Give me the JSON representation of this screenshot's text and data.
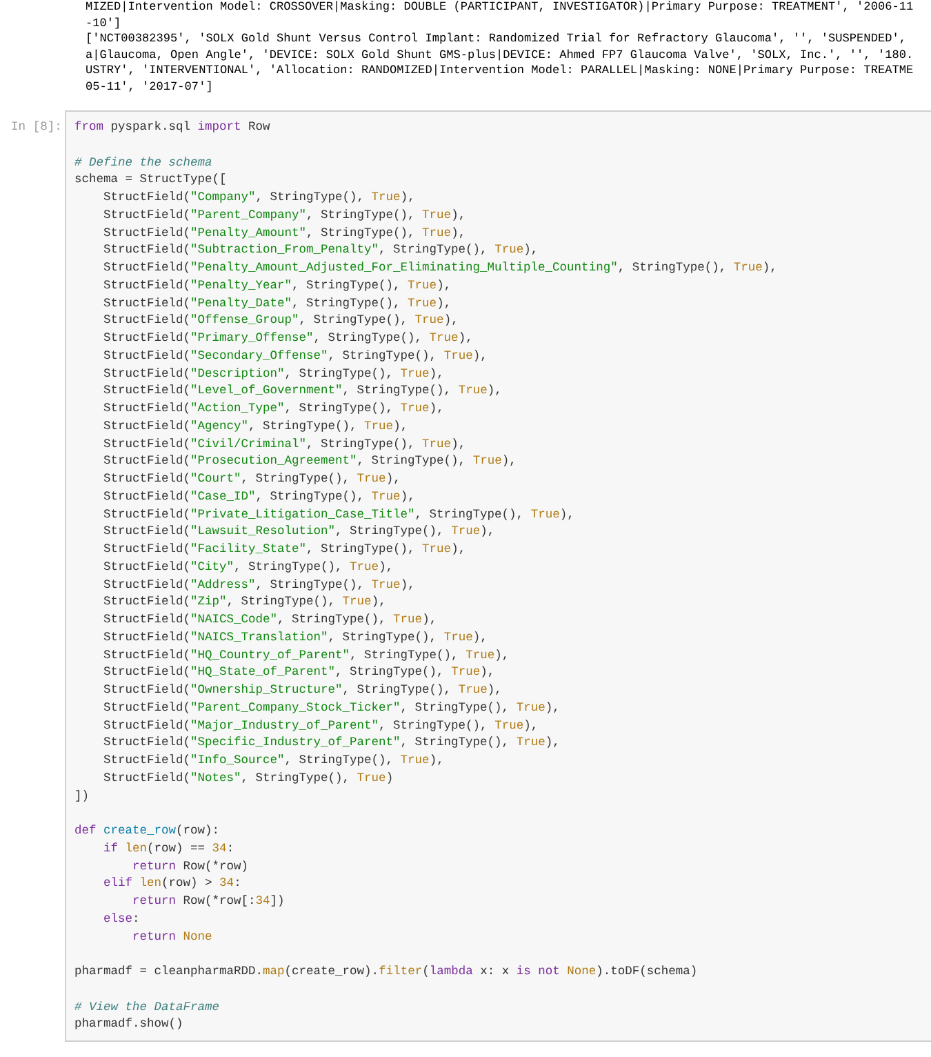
{
  "output": {
    "lines": [
      "MIZED|Intervention Model: CROSSOVER|Masking: DOUBLE (PARTICIPANT, INVESTIGATOR)|Primary Purpose: TREATMENT', '2006-11",
      "-10']",
      "['NCT00382395', 'SOLX Gold Shunt Versus Control Implant: Randomized Trial for Refractory Glaucoma', '', 'SUSPENDED',",
      "a|Glaucoma, Open Angle', 'DEVICE: SOLX Gold Shunt GMS-plus|DEVICE: Ahmed FP7 Glaucoma Valve', 'SOLX, Inc.', '', '180.",
      "USTRY', 'INTERVENTIONAL', 'Allocation: RANDOMIZED|Intervention Model: PARALLEL|Masking: NONE|Primary Purpose: TREATME",
      "05-11', '2017-07']"
    ]
  },
  "cell": {
    "prompt": "In [8]:",
    "lines": [
      {
        "tokens": [
          {
            "kind": "keyword",
            "text": "from"
          },
          {
            "kind": "plain",
            "text": " pyspark.sql "
          },
          {
            "kind": "keyword",
            "text": "import"
          },
          {
            "kind": "plain",
            "text": " Row"
          }
        ]
      },
      {
        "kind": "blank"
      },
      {
        "tokens": [
          {
            "kind": "comment",
            "text": "# Define the schema"
          }
        ]
      },
      {
        "tokens": [
          {
            "kind": "plain",
            "text": "schema = StructType(["
          }
        ]
      },
      {
        "tokens": [
          {
            "kind": "plain",
            "text": "    StructField("
          },
          {
            "kind": "string",
            "text": "\"Company\""
          },
          {
            "kind": "plain",
            "text": ", StringType(), "
          },
          {
            "kind": "constant",
            "text": "True"
          },
          {
            "kind": "plain",
            "text": "),"
          }
        ]
      },
      {
        "tokens": [
          {
            "kind": "plain",
            "text": "    StructField("
          },
          {
            "kind": "string",
            "text": "\"Parent_Company\""
          },
          {
            "kind": "plain",
            "text": ", StringType(), "
          },
          {
            "kind": "constant",
            "text": "True"
          },
          {
            "kind": "plain",
            "text": "),"
          }
        ]
      },
      {
        "tokens": [
          {
            "kind": "plain",
            "text": "    StructField("
          },
          {
            "kind": "string",
            "text": "\"Penalty_Amount\""
          },
          {
            "kind": "plain",
            "text": ", StringType(), "
          },
          {
            "kind": "constant",
            "text": "True"
          },
          {
            "kind": "plain",
            "text": "),"
          }
        ]
      },
      {
        "tokens": [
          {
            "kind": "plain",
            "text": "    StructField("
          },
          {
            "kind": "string",
            "text": "\"Subtraction_From_Penalty\""
          },
          {
            "kind": "plain",
            "text": ", StringType(), "
          },
          {
            "kind": "constant",
            "text": "True"
          },
          {
            "kind": "plain",
            "text": "),"
          }
        ]
      },
      {
        "tokens": [
          {
            "kind": "plain",
            "text": "    StructField("
          },
          {
            "kind": "string",
            "text": "\"Penalty_Amount_Adjusted_For_Eliminating_Multiple_Counting\""
          },
          {
            "kind": "plain",
            "text": ", StringType(), "
          },
          {
            "kind": "constant",
            "text": "True"
          },
          {
            "kind": "plain",
            "text": "),"
          }
        ]
      },
      {
        "tokens": [
          {
            "kind": "plain",
            "text": "    StructField("
          },
          {
            "kind": "string",
            "text": "\"Penalty_Year\""
          },
          {
            "kind": "plain",
            "text": ", StringType(), "
          },
          {
            "kind": "constant",
            "text": "True"
          },
          {
            "kind": "plain",
            "text": "),"
          }
        ]
      },
      {
        "tokens": [
          {
            "kind": "plain",
            "text": "    StructField("
          },
          {
            "kind": "string",
            "text": "\"Penalty_Date\""
          },
          {
            "kind": "plain",
            "text": ", StringType(), "
          },
          {
            "kind": "constant",
            "text": "True"
          },
          {
            "kind": "plain",
            "text": "),"
          }
        ]
      },
      {
        "tokens": [
          {
            "kind": "plain",
            "text": "    StructField("
          },
          {
            "kind": "string",
            "text": "\"Offense_Group\""
          },
          {
            "kind": "plain",
            "text": ", StringType(), "
          },
          {
            "kind": "constant",
            "text": "True"
          },
          {
            "kind": "plain",
            "text": "),"
          }
        ]
      },
      {
        "tokens": [
          {
            "kind": "plain",
            "text": "    StructField("
          },
          {
            "kind": "string",
            "text": "\"Primary_Offense\""
          },
          {
            "kind": "plain",
            "text": ", StringType(), "
          },
          {
            "kind": "constant",
            "text": "True"
          },
          {
            "kind": "plain",
            "text": "),"
          }
        ]
      },
      {
        "tokens": [
          {
            "kind": "plain",
            "text": "    StructField("
          },
          {
            "kind": "string",
            "text": "\"Secondary_Offense\""
          },
          {
            "kind": "plain",
            "text": ", StringType(), "
          },
          {
            "kind": "constant",
            "text": "True"
          },
          {
            "kind": "plain",
            "text": "),"
          }
        ]
      },
      {
        "tokens": [
          {
            "kind": "plain",
            "text": "    StructField("
          },
          {
            "kind": "string",
            "text": "\"Description\""
          },
          {
            "kind": "plain",
            "text": ", StringType(), "
          },
          {
            "kind": "constant",
            "text": "True"
          },
          {
            "kind": "plain",
            "text": "),"
          }
        ]
      },
      {
        "tokens": [
          {
            "kind": "plain",
            "text": "    StructField("
          },
          {
            "kind": "string",
            "text": "\"Level_of_Government\""
          },
          {
            "kind": "plain",
            "text": ", StringType(), "
          },
          {
            "kind": "constant",
            "text": "True"
          },
          {
            "kind": "plain",
            "text": "),"
          }
        ]
      },
      {
        "tokens": [
          {
            "kind": "plain",
            "text": "    StructField("
          },
          {
            "kind": "string",
            "text": "\"Action_Type\""
          },
          {
            "kind": "plain",
            "text": ", StringType(), "
          },
          {
            "kind": "constant",
            "text": "True"
          },
          {
            "kind": "plain",
            "text": "),"
          }
        ]
      },
      {
        "tokens": [
          {
            "kind": "plain",
            "text": "    StructField("
          },
          {
            "kind": "string",
            "text": "\"Agency\""
          },
          {
            "kind": "plain",
            "text": ", StringType(), "
          },
          {
            "kind": "constant",
            "text": "True"
          },
          {
            "kind": "plain",
            "text": "),"
          }
        ]
      },
      {
        "tokens": [
          {
            "kind": "plain",
            "text": "    StructField("
          },
          {
            "kind": "string",
            "text": "\"Civil/Criminal\""
          },
          {
            "kind": "plain",
            "text": ", StringType(), "
          },
          {
            "kind": "constant",
            "text": "True"
          },
          {
            "kind": "plain",
            "text": "),"
          }
        ]
      },
      {
        "tokens": [
          {
            "kind": "plain",
            "text": "    StructField("
          },
          {
            "kind": "string",
            "text": "\"Prosecution_Agreement\""
          },
          {
            "kind": "plain",
            "text": ", StringType(), "
          },
          {
            "kind": "constant",
            "text": "True"
          },
          {
            "kind": "plain",
            "text": "),"
          }
        ]
      },
      {
        "tokens": [
          {
            "kind": "plain",
            "text": "    StructField("
          },
          {
            "kind": "string",
            "text": "\"Court\""
          },
          {
            "kind": "plain",
            "text": ", StringType(), "
          },
          {
            "kind": "constant",
            "text": "True"
          },
          {
            "kind": "plain",
            "text": "),"
          }
        ]
      },
      {
        "tokens": [
          {
            "kind": "plain",
            "text": "    StructField("
          },
          {
            "kind": "string",
            "text": "\"Case_ID\""
          },
          {
            "kind": "plain",
            "text": ", StringType(), "
          },
          {
            "kind": "constant",
            "text": "True"
          },
          {
            "kind": "plain",
            "text": "),"
          }
        ]
      },
      {
        "tokens": [
          {
            "kind": "plain",
            "text": "    StructField("
          },
          {
            "kind": "string",
            "text": "\"Private_Litigation_Case_Title\""
          },
          {
            "kind": "plain",
            "text": ", StringType(), "
          },
          {
            "kind": "constant",
            "text": "True"
          },
          {
            "kind": "plain",
            "text": "),"
          }
        ]
      },
      {
        "tokens": [
          {
            "kind": "plain",
            "text": "    StructField("
          },
          {
            "kind": "string",
            "text": "\"Lawsuit_Resolution\""
          },
          {
            "kind": "plain",
            "text": ", StringType(), "
          },
          {
            "kind": "constant",
            "text": "True"
          },
          {
            "kind": "plain",
            "text": "),"
          }
        ]
      },
      {
        "tokens": [
          {
            "kind": "plain",
            "text": "    StructField("
          },
          {
            "kind": "string",
            "text": "\"Facility_State\""
          },
          {
            "kind": "plain",
            "text": ", StringType(), "
          },
          {
            "kind": "constant",
            "text": "True"
          },
          {
            "kind": "plain",
            "text": "),"
          }
        ]
      },
      {
        "tokens": [
          {
            "kind": "plain",
            "text": "    StructField("
          },
          {
            "kind": "string",
            "text": "\"City\""
          },
          {
            "kind": "plain",
            "text": ", StringType(), "
          },
          {
            "kind": "constant",
            "text": "True"
          },
          {
            "kind": "plain",
            "text": "),"
          }
        ]
      },
      {
        "tokens": [
          {
            "kind": "plain",
            "text": "    StructField("
          },
          {
            "kind": "string",
            "text": "\"Address\""
          },
          {
            "kind": "plain",
            "text": ", StringType(), "
          },
          {
            "kind": "constant",
            "text": "True"
          },
          {
            "kind": "plain",
            "text": "),"
          }
        ]
      },
      {
        "tokens": [
          {
            "kind": "plain",
            "text": "    StructField("
          },
          {
            "kind": "string",
            "text": "\"Zip\""
          },
          {
            "kind": "plain",
            "text": ", StringType(), "
          },
          {
            "kind": "constant",
            "text": "True"
          },
          {
            "kind": "plain",
            "text": "),"
          }
        ]
      },
      {
        "tokens": [
          {
            "kind": "plain",
            "text": "    StructField("
          },
          {
            "kind": "string",
            "text": "\"NAICS_Code\""
          },
          {
            "kind": "plain",
            "text": ", StringType(), "
          },
          {
            "kind": "constant",
            "text": "True"
          },
          {
            "kind": "plain",
            "text": "),"
          }
        ]
      },
      {
        "tokens": [
          {
            "kind": "plain",
            "text": "    StructField("
          },
          {
            "kind": "string",
            "text": "\"NAICS_Translation\""
          },
          {
            "kind": "plain",
            "text": ", StringType(), "
          },
          {
            "kind": "constant",
            "text": "True"
          },
          {
            "kind": "plain",
            "text": "),"
          }
        ]
      },
      {
        "tokens": [
          {
            "kind": "plain",
            "text": "    StructField("
          },
          {
            "kind": "string",
            "text": "\"HQ_Country_of_Parent\""
          },
          {
            "kind": "plain",
            "text": ", StringType(), "
          },
          {
            "kind": "constant",
            "text": "True"
          },
          {
            "kind": "plain",
            "text": "),"
          }
        ]
      },
      {
        "tokens": [
          {
            "kind": "plain",
            "text": "    StructField("
          },
          {
            "kind": "string",
            "text": "\"HQ_State_of_Parent\""
          },
          {
            "kind": "plain",
            "text": ", StringType(), "
          },
          {
            "kind": "constant",
            "text": "True"
          },
          {
            "kind": "plain",
            "text": "),"
          }
        ]
      },
      {
        "tokens": [
          {
            "kind": "plain",
            "text": "    StructField("
          },
          {
            "kind": "string",
            "text": "\"Ownership_Structure\""
          },
          {
            "kind": "plain",
            "text": ", StringType(), "
          },
          {
            "kind": "constant",
            "text": "True"
          },
          {
            "kind": "plain",
            "text": "),"
          }
        ]
      },
      {
        "tokens": [
          {
            "kind": "plain",
            "text": "    StructField("
          },
          {
            "kind": "string",
            "text": "\"Parent_Company_Stock_Ticker\""
          },
          {
            "kind": "plain",
            "text": ", StringType(), "
          },
          {
            "kind": "constant",
            "text": "True"
          },
          {
            "kind": "plain",
            "text": "),"
          }
        ]
      },
      {
        "tokens": [
          {
            "kind": "plain",
            "text": "    StructField("
          },
          {
            "kind": "string",
            "text": "\"Major_Industry_of_Parent\""
          },
          {
            "kind": "plain",
            "text": ", StringType(), "
          },
          {
            "kind": "constant",
            "text": "True"
          },
          {
            "kind": "plain",
            "text": "),"
          }
        ]
      },
      {
        "tokens": [
          {
            "kind": "plain",
            "text": "    StructField("
          },
          {
            "kind": "string",
            "text": "\"Specific_Industry_of_Parent\""
          },
          {
            "kind": "plain",
            "text": ", StringType(), "
          },
          {
            "kind": "constant",
            "text": "True"
          },
          {
            "kind": "plain",
            "text": "),"
          }
        ]
      },
      {
        "tokens": [
          {
            "kind": "plain",
            "text": "    StructField("
          },
          {
            "kind": "string",
            "text": "\"Info_Source\""
          },
          {
            "kind": "plain",
            "text": ", StringType(), "
          },
          {
            "kind": "constant",
            "text": "True"
          },
          {
            "kind": "plain",
            "text": "),"
          }
        ]
      },
      {
        "tokens": [
          {
            "kind": "plain",
            "text": "    StructField("
          },
          {
            "kind": "string",
            "text": "\"Notes\""
          },
          {
            "kind": "plain",
            "text": ", StringType(), "
          },
          {
            "kind": "constant",
            "text": "True"
          },
          {
            "kind": "plain",
            "text": ")"
          }
        ]
      },
      {
        "tokens": [
          {
            "kind": "plain",
            "text": "])"
          }
        ]
      },
      {
        "kind": "blank"
      },
      {
        "tokens": [
          {
            "kind": "keyword",
            "text": "def"
          },
          {
            "kind": "definition",
            "text": " create_row"
          },
          {
            "kind": "plain",
            "text": "(row):"
          }
        ]
      },
      {
        "tokens": [
          {
            "kind": "keyword",
            "text": "    if"
          },
          {
            "kind": "builtin",
            "text": " len"
          },
          {
            "kind": "plain",
            "text": "(row) == "
          },
          {
            "kind": "number",
            "text": "34"
          },
          {
            "kind": "plain",
            "text": ":"
          }
        ]
      },
      {
        "tokens": [
          {
            "kind": "keyword",
            "text": "        return"
          },
          {
            "kind": "plain",
            "text": " Row(*row)"
          }
        ]
      },
      {
        "tokens": [
          {
            "kind": "keyword",
            "text": "    elif"
          },
          {
            "kind": "builtin",
            "text": " len"
          },
          {
            "kind": "plain",
            "text": "(row) > "
          },
          {
            "kind": "number",
            "text": "34"
          },
          {
            "kind": "plain",
            "text": ":"
          }
        ]
      },
      {
        "tokens": [
          {
            "kind": "keyword",
            "text": "        return"
          },
          {
            "kind": "plain",
            "text": " Row(*row[:"
          },
          {
            "kind": "number",
            "text": "34"
          },
          {
            "kind": "plain",
            "text": "])"
          }
        ]
      },
      {
        "tokens": [
          {
            "kind": "keyword",
            "text": "    else"
          },
          {
            "kind": "plain",
            "text": ":"
          }
        ]
      },
      {
        "tokens": [
          {
            "kind": "keyword",
            "text": "        return"
          },
          {
            "kind": "constant",
            "text": " None"
          }
        ]
      },
      {
        "kind": "blank"
      },
      {
        "tokens": [
          {
            "kind": "plain",
            "text": "pharmadf = cleanpharmaRDD."
          },
          {
            "kind": "builtin",
            "text": "map"
          },
          {
            "kind": "plain",
            "text": "(create_row)."
          },
          {
            "kind": "builtin",
            "text": "filter"
          },
          {
            "kind": "plain",
            "text": "("
          },
          {
            "kind": "keyword",
            "text": "lambda"
          },
          {
            "kind": "plain",
            "text": " x: x "
          },
          {
            "kind": "keyword",
            "text": "is"
          },
          {
            "kind": "keyword",
            "text": " not"
          },
          {
            "kind": "constant",
            "text": " None"
          },
          {
            "kind": "plain",
            "text": ").toDF(schema)"
          }
        ]
      },
      {
        "kind": "blank"
      },
      {
        "tokens": [
          {
            "kind": "comment",
            "text": "# View the DataFrame"
          }
        ]
      },
      {
        "tokens": [
          {
            "kind": "plain",
            "text": "pharmadf.show()"
          }
        ]
      }
    ]
  }
}
